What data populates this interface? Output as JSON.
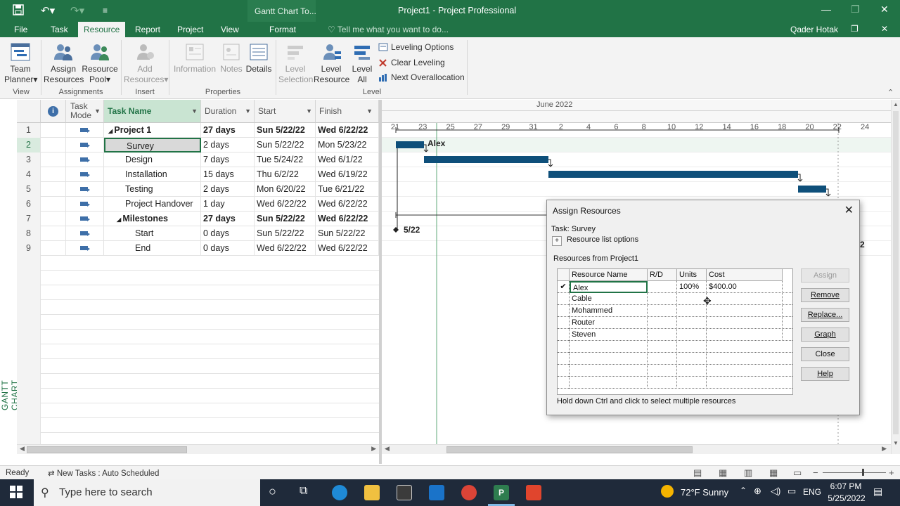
{
  "window": {
    "title": "Project1 - Project Professional",
    "context_group": "Gantt Chart To...",
    "user": "Qader Hotak",
    "tell_me": "Tell me what you want to do..."
  },
  "tabs": [
    "File",
    "Task",
    "Resource",
    "Report",
    "Project",
    "View",
    "Format"
  ],
  "ribbon": {
    "team_planner": "Team",
    "team_planner2": "Planner",
    "assign": "Assign",
    "assign2": "Resources",
    "pool": "Resource",
    "pool2": "Pool",
    "add": "Add",
    "add2": "Resources",
    "information": "Information",
    "notes": "Notes",
    "details": "Details",
    "level_sel": "Level",
    "level_sel2": "Selection",
    "level_res": "Level",
    "level_res2": "Resource",
    "level_all": "Level",
    "level_all2": "All",
    "leveling_options": "Leveling Options",
    "clear_leveling": "Clear Leveling",
    "next_overalloc": "Next Overallocation",
    "groups": {
      "view": "View",
      "assignments": "Assignments",
      "insert": "Insert",
      "properties": "Properties",
      "level": "Level"
    }
  },
  "side_label": "GANTT CHART",
  "grid": {
    "headers": {
      "info": "i",
      "mode": "Task",
      "mode2": "Mode",
      "name": "Task Name",
      "duration": "Duration",
      "start": "Start",
      "finish": "Finish"
    },
    "rows": [
      {
        "id": "1",
        "name": "Project 1",
        "duration": "27 days",
        "start": "Sun 5/22/22",
        "finish": "Wed 6/22/22"
      },
      {
        "id": "2",
        "name": "Survey",
        "duration": "2 days",
        "start": "Sun 5/22/22",
        "finish": "Mon 5/23/22"
      },
      {
        "id": "3",
        "name": "Design",
        "duration": "7 days",
        "start": "Tue 5/24/22",
        "finish": "Wed 6/1/22"
      },
      {
        "id": "4",
        "name": "Installation",
        "duration": "15 days",
        "start": "Thu 6/2/22",
        "finish": "Wed 6/19/22"
      },
      {
        "id": "5",
        "name": "Testing",
        "duration": "2 days",
        "start": "Mon 6/20/22",
        "finish": "Tue 6/21/22"
      },
      {
        "id": "6",
        "name": "Project Handover",
        "duration": "1 day",
        "start": "Wed 6/22/22",
        "finish": "Wed 6/22/22"
      },
      {
        "id": "7",
        "name": "Milestones",
        "duration": "27 days",
        "start": "Sun 5/22/22",
        "finish": "Wed 6/22/22"
      },
      {
        "id": "8",
        "name": "Start",
        "duration": "0 days",
        "start": "Sun 5/22/22",
        "finish": "Sun 5/22/22"
      },
      {
        "id": "9",
        "name": "End",
        "duration": "0 days",
        "start": "Wed 6/22/22",
        "finish": "Wed 6/22/22"
      }
    ]
  },
  "gantt": {
    "month": "June 2022",
    "days": [
      "21",
      "23",
      "25",
      "27",
      "29",
      "31",
      "2",
      "4",
      "6",
      "8",
      "10",
      "12",
      "14",
      "16",
      "18",
      "20",
      "22",
      "24"
    ],
    "bar_label": "Alex",
    "milestone_label": "5/22",
    "milestone_end_label_partial": "2"
  },
  "dialog": {
    "title": "Assign Resources",
    "task": "Task: Survey",
    "options": "Resource list options",
    "options_toggle": "+",
    "from": "Resources from Project1",
    "columns": {
      "name": "Resource Name",
      "rd": "R/D",
      "units": "Units",
      "cost": "Cost"
    },
    "resources": [
      {
        "check": "✔",
        "name": "Alex",
        "rd": "",
        "units": "100%",
        "cost": "$400.00"
      },
      {
        "check": "",
        "name": "Cable",
        "rd": "",
        "units": "",
        "cost": ""
      },
      {
        "check": "",
        "name": "Mohammed",
        "rd": "",
        "units": "",
        "cost": ""
      },
      {
        "check": "",
        "name": "Router",
        "rd": "",
        "units": "",
        "cost": ""
      },
      {
        "check": "",
        "name": "Steven",
        "rd": "",
        "units": "",
        "cost": ""
      }
    ],
    "buttons": {
      "assign": "Assign",
      "remove": "Remove",
      "replace": "Replace...",
      "graph": "Graph",
      "close": "Close",
      "help": "Help"
    },
    "hint": "Hold down Ctrl and click to select multiple resources"
  },
  "status": {
    "ready": "Ready",
    "new_tasks": "New Tasks : Auto Scheduled"
  },
  "taskbar": {
    "search": "Type here to search",
    "weather": "72°F  Sunny",
    "lang": "ENG",
    "time": "6:07 PM",
    "date": "5/25/2022"
  },
  "colors": {
    "accent": "#217346",
    "bar": "#0e4f7a"
  }
}
